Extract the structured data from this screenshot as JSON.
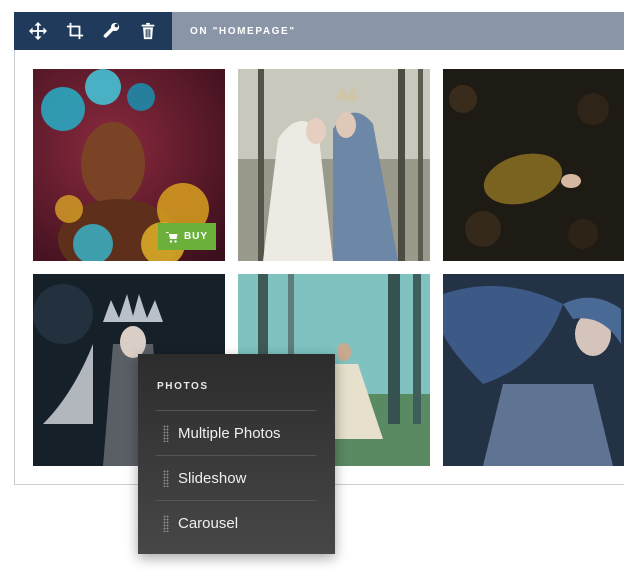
{
  "toolbar": {
    "tools": [
      {
        "name": "move-icon"
      },
      {
        "name": "crop-icon"
      },
      {
        "name": "wrench-icon"
      },
      {
        "name": "trash-icon"
      }
    ],
    "label": "ON \"HOMEPAGE\""
  },
  "gallery": {
    "buy_label": "BUY",
    "buy_color": "#6ab03a"
  },
  "menu": {
    "title": "PHOTOS",
    "items": [
      {
        "label": "Multiple Photos"
      },
      {
        "label": "Slideshow"
      },
      {
        "label": "Carousel"
      }
    ]
  },
  "colors": {
    "toolbar_dark": "#1f3a5a",
    "toolbar_light": "#8a96a7",
    "menu_bg": "#3a3a3a"
  }
}
